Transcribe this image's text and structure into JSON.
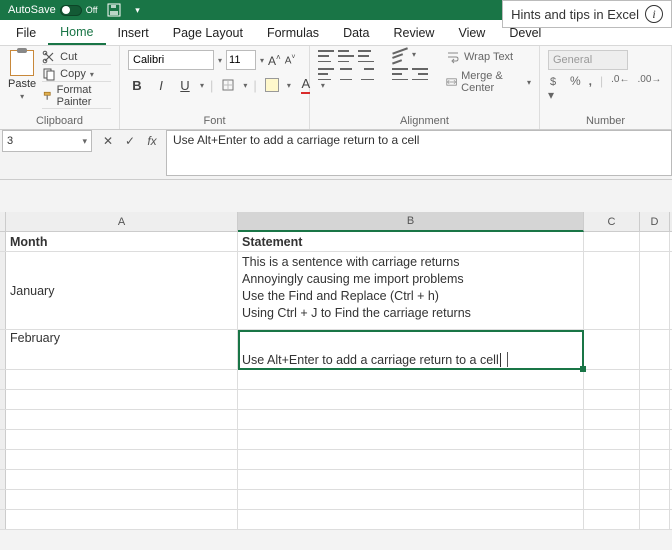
{
  "titlebar": {
    "autosave": "AutoSave",
    "autosave_state": "Off"
  },
  "hints": {
    "text": "Hints and tips in Excel"
  },
  "tabs": {
    "file": "File",
    "home": "Home",
    "insert": "Insert",
    "pagelayout": "Page Layout",
    "formulas": "Formulas",
    "data": "Data",
    "review": "Review",
    "view": "View",
    "developer": "Devel"
  },
  "ribbon": {
    "clipboard": {
      "label": "Clipboard",
      "paste": "Paste",
      "cut": "Cut",
      "copy": "Copy",
      "format_painter": "Format Painter"
    },
    "font": {
      "label": "Font",
      "name": "Calibri",
      "size": "11",
      "grow": "A˄",
      "shrink": "A˅",
      "bold": "B",
      "italic": "I",
      "underline": "U"
    },
    "alignment": {
      "label": "Alignment",
      "wrap": "Wrap Text",
      "merge": "Merge & Center"
    },
    "number": {
      "label": "Number",
      "format": "General",
      "currency": "$",
      "percent": "%",
      "comma": ",",
      "dec_inc": "←.0",
      "dec_dec": ".00→"
    }
  },
  "fxbar": {
    "name_box": "3",
    "formula": "Use Alt+Enter to add a carriage return to a cell"
  },
  "columns": {
    "A": "A",
    "B": "B",
    "C": "C",
    "D": "D"
  },
  "cells": {
    "header_month": "Month",
    "header_statement": "Statement",
    "january": "January",
    "jan_lines": [
      "This is a sentence with carriage returns",
      "Annoyingly causing me import problems",
      "Use the Find and Replace (Ctrl + h)",
      "Using Ctrl + J to Find the carriage returns"
    ],
    "february": "February",
    "feb_text": "Use Alt+Enter to add a carriage return to a cell"
  }
}
